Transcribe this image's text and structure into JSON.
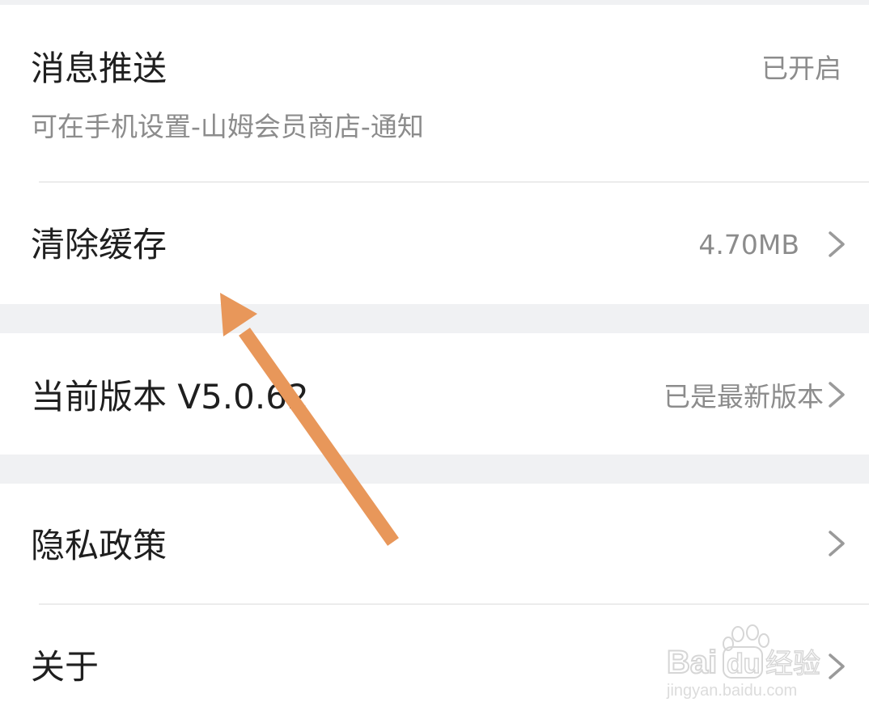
{
  "rows": {
    "push": {
      "title": "消息推送",
      "status": "已开启",
      "subtitle": "可在手机设置-山姆会员商店-通知"
    },
    "cache": {
      "title": "清除缓存",
      "size": "4.70MB"
    },
    "version": {
      "title": "当前版本 V5.0.62",
      "status": "已是最新版本"
    },
    "privacy": {
      "title": "隐私政策"
    },
    "about": {
      "title": "关于"
    }
  },
  "watermark": {
    "brand": "Bai",
    "brand2": "du",
    "product": "经验",
    "url": "jingyan.baidu.com"
  },
  "colors": {
    "arrow": "#e8975a",
    "section_gap": "#f0f1f3",
    "secondary_text": "#8c8c8c"
  }
}
